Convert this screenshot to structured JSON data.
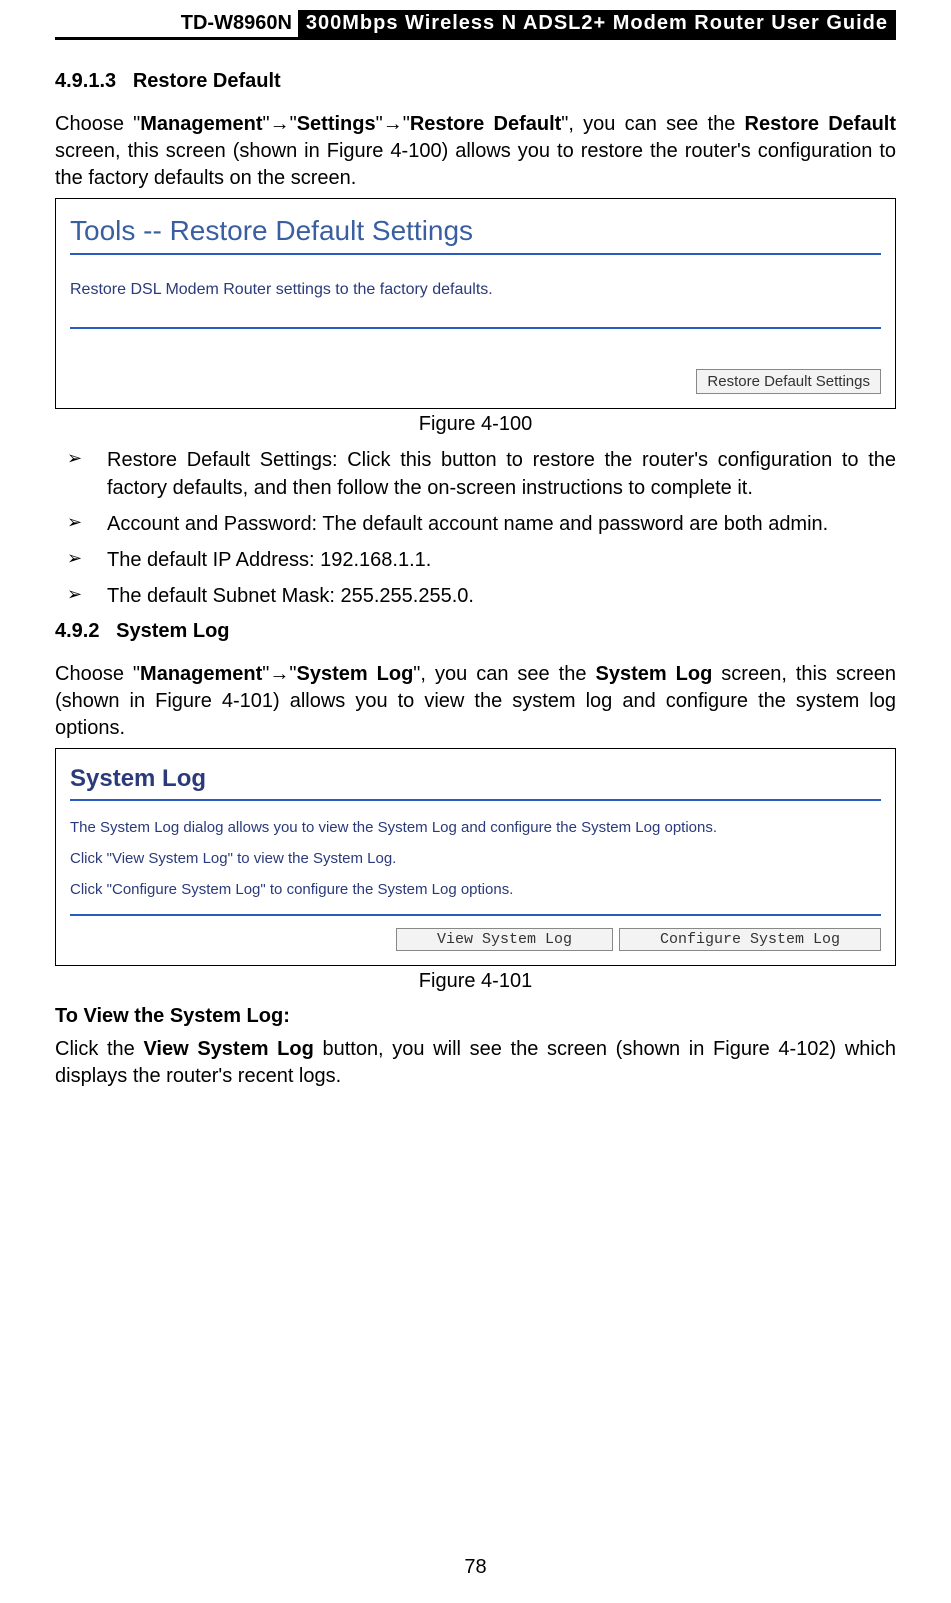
{
  "header": {
    "model": "TD-W8960N",
    "title": "300Mbps Wireless N ADSL2+ Modem Router User Guide"
  },
  "sec1": {
    "num": "4.9.1.3",
    "title": "Restore Default",
    "para_prefix": "Choose \"",
    "bc1": "Management",
    "arrow": "\"→\"",
    "bc2": "Settings",
    "bc3": "Restore Default",
    "para_mid": "\", you can see the ",
    "bold_restore": "Restore Default",
    "para_tail": " screen, this screen (shown in Figure 4-100) allows you to restore the router's configuration to the factory defaults on the screen."
  },
  "fig100": {
    "heading": "Tools -- Restore Default Settings",
    "sub": "Restore DSL Modem Router settings to the factory defaults.",
    "button": "Restore Default Settings",
    "caption": "Figure 4-100"
  },
  "bullets": {
    "b1_strong": "Restore Default Settings:",
    "b1_rest": " Click this button to restore the router's configuration to the factory defaults, and then follow the on-screen instructions to complete it.",
    "b2_strong1": "Account and Password:",
    "b2_mid": " The default ",
    "b2_strong2": "account name",
    "b2_and": " and ",
    "b2_strong3": "password",
    "b2_rest": " are both admin.",
    "b3_pre": "The default ",
    "b3_strong": "IP Address:",
    "b3_rest": " 192.168.1.1.",
    "b4_pre": "The default ",
    "b4_strong": "Subnet Mask:",
    "b4_rest": " 255.255.255.0."
  },
  "sec2": {
    "num": "4.9.2",
    "title": "System Log",
    "para_prefix": "Choose \"",
    "bc1": "Management",
    "arrow": "\"→\"",
    "bc2": "System Log",
    "para_mid": "\", you can see the ",
    "bold_sl": "System Log",
    "para_tail": " screen, this screen (shown in Figure 4-101) allows you to view the system log and configure the system log options."
  },
  "fig101": {
    "heading": "System Log",
    "p1": "The System Log dialog allows you to view the System Log and configure the System Log options.",
    "p2": "Click \"View System Log\" to view the System Log.",
    "p3": "Click \"Configure System Log\" to configure the System Log options.",
    "btn1": "View System Log",
    "btn2": "Configure System Log",
    "caption": "Figure 4-101"
  },
  "tail": {
    "h": "To View the System Log:",
    "p_pre": "Click the ",
    "p_strong": "View System Log",
    "p_rest": " button, you will see the screen (shown in Figure 4-102) which displays the router's recent logs."
  },
  "page_no": "78"
}
